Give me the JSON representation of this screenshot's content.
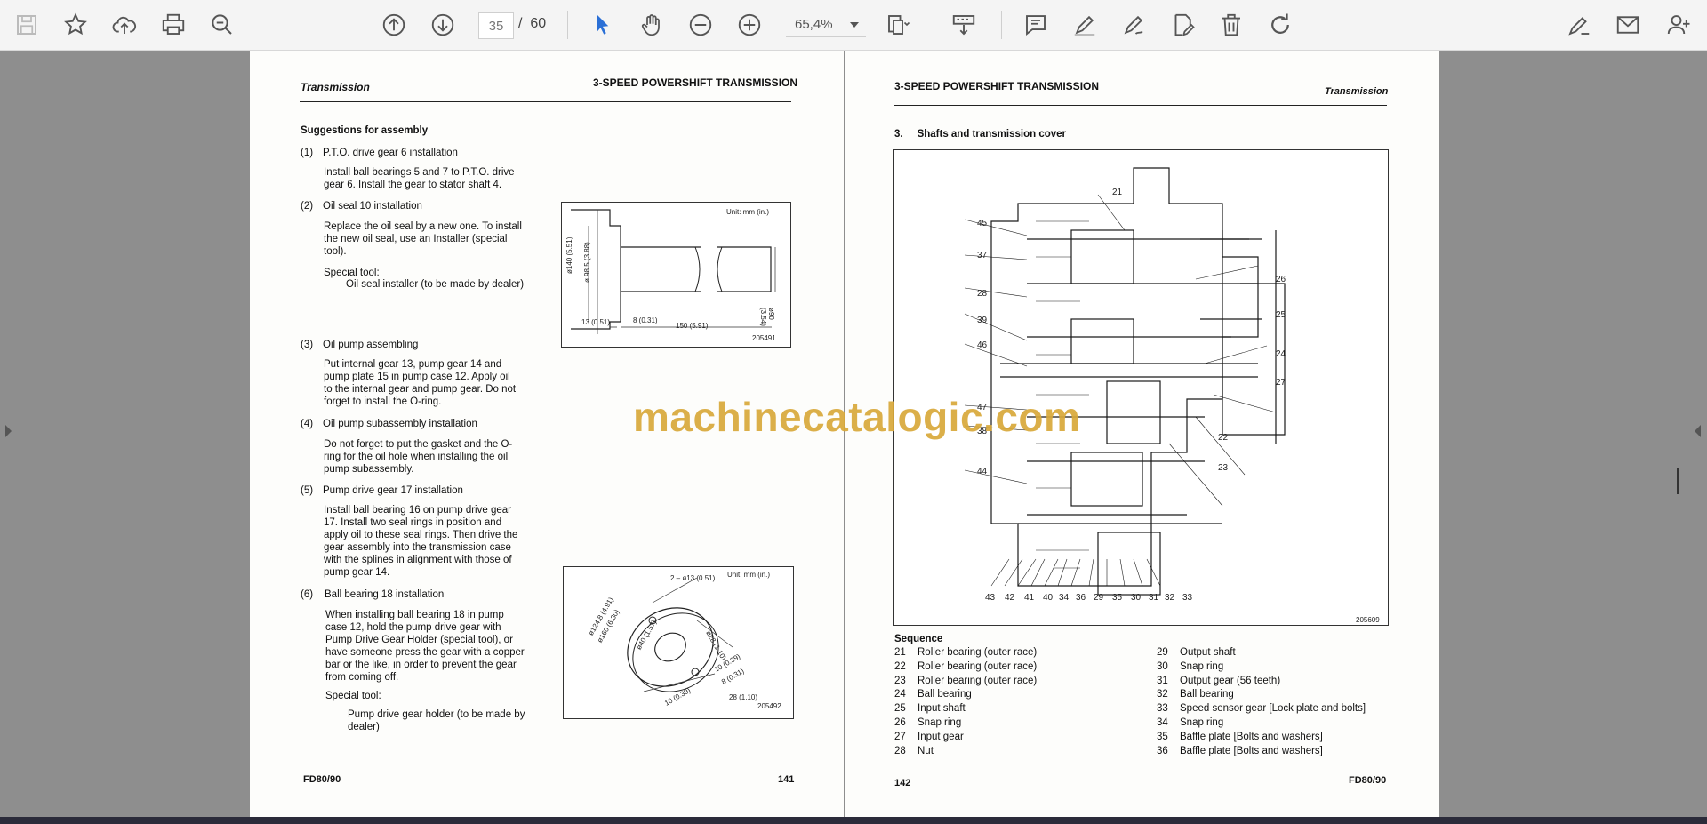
{
  "toolbar": {
    "current_page": "35",
    "page_separator": "/",
    "total_pages": "60",
    "zoom": "65,4%"
  },
  "left_page": {
    "header_left": "Transmission",
    "header_right": "3-SPEED POWERSHIFT TRANSMISSION",
    "section_title": "Suggestions for assembly",
    "items": [
      {
        "num": "(1)",
        "title": "P.T.O. drive gear 6 installation",
        "body": [
          "Install ball bearings 5 and 7 to P.T.O. drive",
          "gear 6.  Install the gear to stator shaft 4."
        ]
      },
      {
        "num": "(2)",
        "title": "Oil seal 10 installation",
        "body": [
          "Replace the oil seal by a new one.  To install",
          "the new oil seal, use an Installer (special",
          "tool)."
        ]
      },
      {
        "num": "(3)",
        "title": "Oil pump assembling",
        "body": [
          "Put internal gear 13, pump gear 14 and",
          "pump plate 15 in pump case 12.  Apply oil",
          "to the internal gear and pump gear.  Do not",
          "forget to install the O-ring."
        ]
      },
      {
        "num": "(4)",
        "title": "Oil pump subassembly installation",
        "body": [
          "Do not forget to put the gasket and the O-",
          "ring for the oil hole when installing the oil",
          "pump subassembly."
        ]
      },
      {
        "num": "(5)",
        "title": "Pump drive gear 17 installation",
        "body": [
          "Install ball bearing 16 on pump drive gear",
          "17.  Install two seal rings in position and",
          "apply oil to these seal rings.  Then drive the",
          "gear assembly into the transmission case",
          "with the splines in alignment with those of",
          "pump gear 14."
        ]
      },
      {
        "num": "(6)",
        "title": "Ball bearing 18 installation",
        "body": [
          "When installing ball bearing 18 in pump",
          "case 12, hold the pump drive gear with",
          "Pump Drive Gear Holder (special tool), or",
          "have someone press the gear with a copper",
          "bar or the like, in order to prevent the gear",
          "from coming off."
        ]
      }
    ],
    "special_tool_label_1": "Special tool:",
    "special_tool_value_1": "Oil seal installer (to be made by dealer)",
    "special_tool_label_2": "Special tool:",
    "special_tool_value_2": [
      "Pump drive gear holder (to be made by",
      "dealer)"
    ],
    "fig1": {
      "unit": "Unit: mm (in.)",
      "code": "205491",
      "dims": [
        "ø140 (5.51)",
        "ø 98.5 (3.88)",
        "13 (0.51)",
        "8 (0.31)",
        "150 (5.91)",
        "ø90 (3.54)"
      ]
    },
    "fig2": {
      "unit": "Unit: mm (in.)",
      "code": "205492",
      "dims": [
        "2 – ø13 (0.51)",
        "ø124.8 (4.91)",
        "ø40 (1.57)",
        "ø160 (6.30)",
        "ø28 (1.10)",
        "10 (0.39)",
        "8 (0.31)",
        "10 (0.39)",
        "28 (1.10)"
      ]
    },
    "footer_left": "FD80/90",
    "footer_right": "141"
  },
  "right_page": {
    "header_left": "3-SPEED POWERSHIFT TRANSMISSION",
    "header_right": "Transmission",
    "section_title": "3.     Shafts and transmission cover",
    "diagram_code": "205609",
    "callouts_left": [
      "21",
      "45",
      "37",
      "28",
      "39",
      "46",
      "47",
      "38",
      "44"
    ],
    "callouts_right": [
      "26",
      "25",
      "24",
      "27",
      "22",
      "23"
    ],
    "callouts_bottom": [
      "43",
      "42",
      "41",
      "40",
      "34",
      "36",
      "29",
      "35",
      "30",
      "31",
      "32",
      "33"
    ],
    "sequence_title": "Sequence",
    "sequence_left": [
      {
        "n": "21",
        "t": "Roller bearing (outer race)"
      },
      {
        "n": "22",
        "t": "Roller bearing (outer race)"
      },
      {
        "n": "23",
        "t": "Roller bearing (outer race)"
      },
      {
        "n": "24",
        "t": "Ball bearing"
      },
      {
        "n": "25",
        "t": "Input shaft"
      },
      {
        "n": "26",
        "t": "Snap ring"
      },
      {
        "n": "27",
        "t": "Input gear"
      },
      {
        "n": "28",
        "t": "Nut"
      }
    ],
    "sequence_right": [
      {
        "n": "29",
        "t": "Output shaft"
      },
      {
        "n": "30",
        "t": "Snap ring"
      },
      {
        "n": "31",
        "t": "Output gear (56 teeth)"
      },
      {
        "n": "32",
        "t": "Ball bearing"
      },
      {
        "n": "33",
        "t": "Speed sensor gear [Lock plate and bolts]"
      },
      {
        "n": "34",
        "t": "Snap ring"
      },
      {
        "n": "35",
        "t": "Baffle plate [Bolts and washers]"
      },
      {
        "n": "36",
        "t": "Baffle plate [Bolts and washers]"
      }
    ],
    "footer_left": "142",
    "footer_right": "FD80/90"
  },
  "watermark": "machinecatalogic.com"
}
